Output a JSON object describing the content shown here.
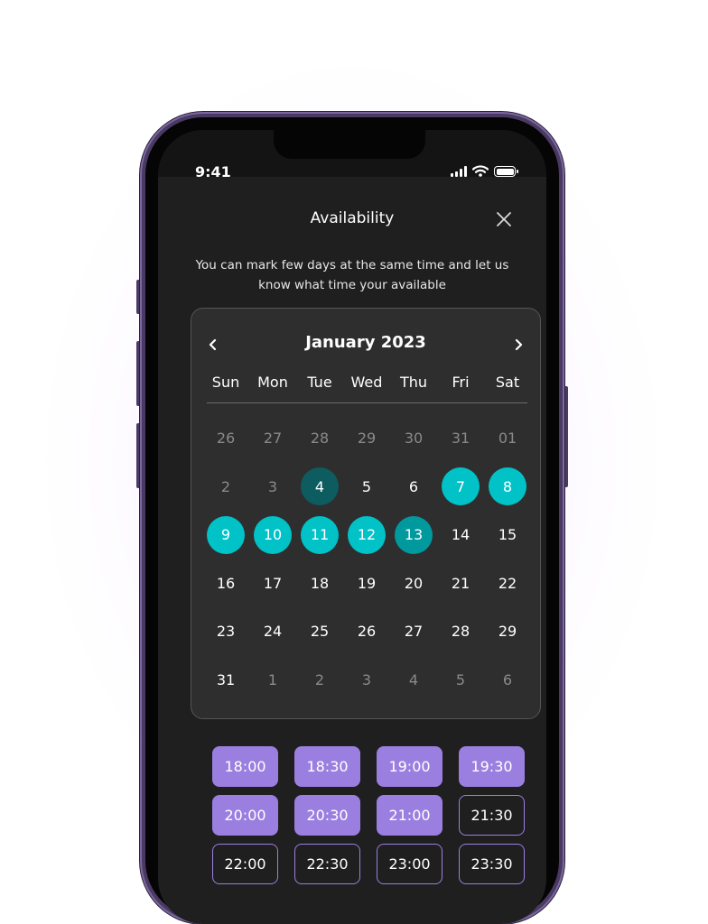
{
  "status_bar": {
    "time": "9:41"
  },
  "header": {
    "title": "Availability",
    "close_icon": "close-icon"
  },
  "subtitle": "You can mark few days at the same time and let us know what time your available",
  "calendar": {
    "month_label": "January 2023",
    "prev_icon": "chevron-left-icon",
    "next_icon": "chevron-right-icon",
    "weekdays": [
      "Sun",
      "Mon",
      "Tue",
      "Wed",
      "Thu",
      "Fri",
      "Sat"
    ],
    "days": [
      {
        "label": "26",
        "state": "muted"
      },
      {
        "label": "27",
        "state": "muted"
      },
      {
        "label": "28",
        "state": "muted"
      },
      {
        "label": "29",
        "state": "muted"
      },
      {
        "label": "30",
        "state": "muted"
      },
      {
        "label": "31",
        "state": "muted"
      },
      {
        "label": "01",
        "state": "muted"
      },
      {
        "label": "2",
        "state": "muted"
      },
      {
        "label": "3",
        "state": "muted"
      },
      {
        "label": "4",
        "state": "selected-dark"
      },
      {
        "label": "5",
        "state": "normal"
      },
      {
        "label": "6",
        "state": "normal"
      },
      {
        "label": "7",
        "state": "selected"
      },
      {
        "label": "8",
        "state": "selected"
      },
      {
        "label": "9",
        "state": "selected"
      },
      {
        "label": "10",
        "state": "selected"
      },
      {
        "label": "11",
        "state": "selected"
      },
      {
        "label": "12",
        "state": "selected"
      },
      {
        "label": "13",
        "state": "selected-mid"
      },
      {
        "label": "14",
        "state": "normal"
      },
      {
        "label": "15",
        "state": "normal"
      },
      {
        "label": "16",
        "state": "normal"
      },
      {
        "label": "17",
        "state": "normal"
      },
      {
        "label": "18",
        "state": "normal"
      },
      {
        "label": "19",
        "state": "normal"
      },
      {
        "label": "20",
        "state": "normal"
      },
      {
        "label": "21",
        "state": "normal"
      },
      {
        "label": "22",
        "state": "normal"
      },
      {
        "label": "23",
        "state": "normal"
      },
      {
        "label": "24",
        "state": "normal"
      },
      {
        "label": "25",
        "state": "normal"
      },
      {
        "label": "26",
        "state": "normal"
      },
      {
        "label": "27",
        "state": "normal"
      },
      {
        "label": "28",
        "state": "normal"
      },
      {
        "label": "29",
        "state": "normal"
      },
      {
        "label": "31",
        "state": "normal"
      },
      {
        "label": "1",
        "state": "muted"
      },
      {
        "label": "2",
        "state": "muted"
      },
      {
        "label": "3",
        "state": "muted"
      },
      {
        "label": "4",
        "state": "muted"
      },
      {
        "label": "5",
        "state": "muted"
      },
      {
        "label": "6",
        "state": "muted"
      }
    ]
  },
  "time_slots": [
    {
      "label": "18:00",
      "selected": true
    },
    {
      "label": "18:30",
      "selected": true
    },
    {
      "label": "19:00",
      "selected": true
    },
    {
      "label": "19:30",
      "selected": true
    },
    {
      "label": "20:00",
      "selected": true
    },
    {
      "label": "20:30",
      "selected": true
    },
    {
      "label": "21:00",
      "selected": true
    },
    {
      "label": "21:30",
      "selected": false
    },
    {
      "label": "22:00",
      "selected": false
    },
    {
      "label": "22:30",
      "selected": false
    },
    {
      "label": "23:00",
      "selected": false
    },
    {
      "label": "23:30",
      "selected": false
    }
  ],
  "colors": {
    "accent_teal": "#00c2c7",
    "accent_teal_dark": "#0d5c60",
    "accent_purple": "#9b7fe0",
    "screen_bg": "#1f1f1f",
    "card_bg": "#2e2e2e"
  }
}
